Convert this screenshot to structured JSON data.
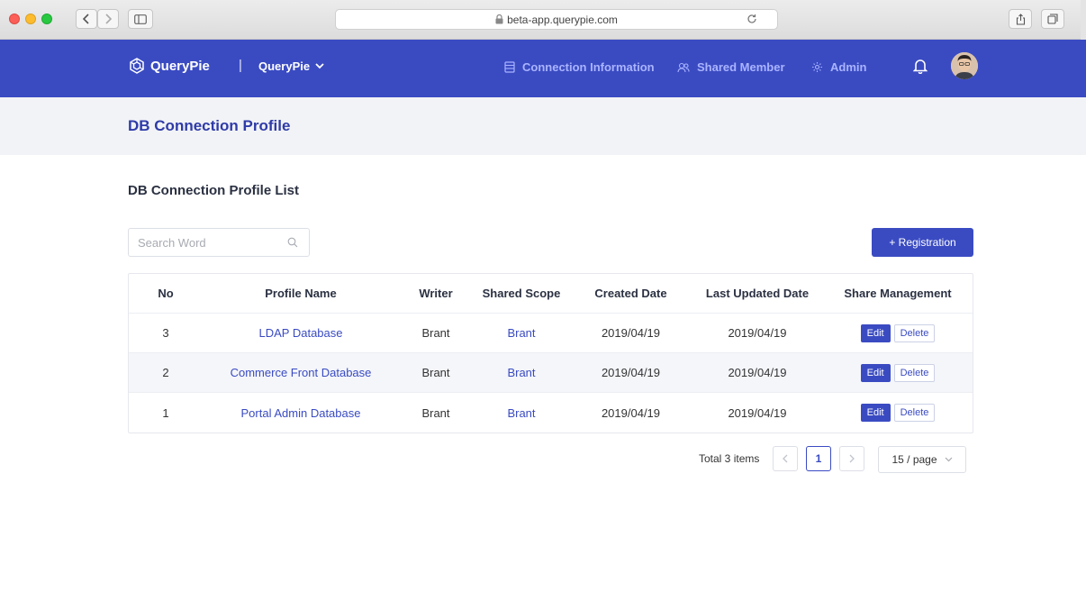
{
  "browser": {
    "url": "beta-app.querypie.com"
  },
  "header": {
    "logo_text": "QueryPie",
    "separator": "|",
    "project": "QueryPie",
    "nav": [
      {
        "label": "Connection Information",
        "icon": "database-list-icon"
      },
      {
        "label": "Shared Member",
        "icon": "users-icon"
      },
      {
        "label": "Admin",
        "icon": "gear-icon"
      }
    ],
    "accent_color": "#3a4bc2"
  },
  "page": {
    "title": "DB Connection Profile",
    "section_title": "DB Connection Profile List"
  },
  "search": {
    "placeholder": "Search Word",
    "value": ""
  },
  "registration_label": "+ Registration",
  "table": {
    "columns": [
      "No",
      "Profile Name",
      "Writer",
      "Shared Scope",
      "Created Date",
      "Last Updated Date",
      "Share Management"
    ],
    "rows": [
      {
        "no": "3",
        "name": "LDAP Database",
        "writer": "Brant",
        "scope": "Brant",
        "created": "2019/04/19",
        "updated": "2019/04/19"
      },
      {
        "no": "2",
        "name": "Commerce Front Database",
        "writer": "Brant",
        "scope": "Brant",
        "created": "2019/04/19",
        "updated": "2019/04/19"
      },
      {
        "no": "1",
        "name": "Portal Admin Database",
        "writer": "Brant",
        "scope": "Brant",
        "created": "2019/04/19",
        "updated": "2019/04/19"
      }
    ],
    "edit_label": "Edit",
    "delete_label": "Delete"
  },
  "pagination": {
    "total": "Total 3 items",
    "current_page": "1",
    "page_size": "15 / page"
  }
}
